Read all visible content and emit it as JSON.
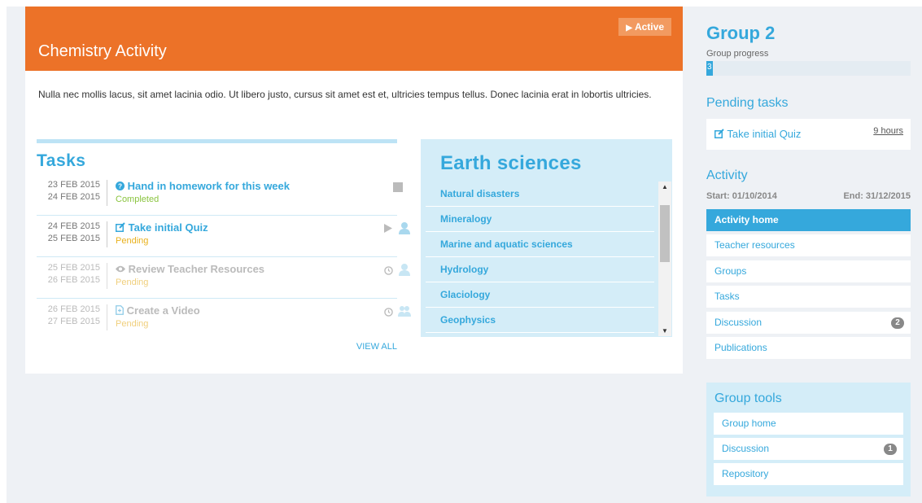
{
  "activity": {
    "title": "Chemistry Activity",
    "status_badge": "Active",
    "description": "Nulla nec mollis lacus, sit amet lacinia odio. Ut libero justo, cursus sit amet est et, ultricies tempus tellus. Donec lacinia erat in lobortis ultricies."
  },
  "tasks": {
    "title": "Tasks",
    "view_all": "VIEW ALL",
    "items": [
      {
        "start": "23 FEB 2015",
        "end": "24 FEB 2015",
        "name": "Hand in homework for this week",
        "status": "Completed",
        "icon": "question-circle-icon",
        "actions": [
          "stop-icon"
        ]
      },
      {
        "start": "24 FEB 2015",
        "end": "25 FEB 2015",
        "name": "Take initial Quiz",
        "status": "Pending",
        "icon": "edit-icon",
        "actions": [
          "play-icon",
          "user-icon"
        ]
      },
      {
        "start": "25 FEB 2015",
        "end": "26 FEB 2015",
        "name": "Review Teacher Resources",
        "status": "Pending",
        "icon": "eye-icon",
        "actions": [
          "clock-icon",
          "user-icon"
        ]
      },
      {
        "start": "26 FEB 2015",
        "end": "27 FEB 2015",
        "name": "Create a Video",
        "status": "Pending",
        "icon": "file-icon",
        "actions": [
          "clock-icon",
          "users-icon"
        ]
      }
    ]
  },
  "earth_sciences": {
    "title": "Earth sciences",
    "items": [
      "Natural disasters",
      "Mineralogy",
      "Marine and aquatic sciences",
      "Hydrology",
      "Glaciology",
      "Geophysics"
    ]
  },
  "group": {
    "title": "Group 2",
    "progress_label": "Group progress",
    "progress_value": "3",
    "progress_percent": 3
  },
  "pending": {
    "title": "Pending tasks",
    "task": "Take initial Quiz",
    "time": "9 hours"
  },
  "activity_nav": {
    "title": "Activity",
    "start": "Start: 01/10/2014",
    "end": "End: 31/12/2015",
    "items": [
      {
        "label": "Activity home",
        "active": true
      },
      {
        "label": "Teacher resources"
      },
      {
        "label": "Groups"
      },
      {
        "label": "Tasks"
      },
      {
        "label": "Discussion",
        "badge": "2"
      },
      {
        "label": "Publications"
      }
    ]
  },
  "group_tools": {
    "title": "Group tools",
    "items": [
      {
        "label": "Group home"
      },
      {
        "label": "Discussion",
        "badge": "1"
      },
      {
        "label": "Repository"
      }
    ]
  },
  "colors": {
    "header": "#ec7228",
    "accent": "#35a8dc",
    "completed": "#8ac43f",
    "pending": "#e9b11d"
  }
}
